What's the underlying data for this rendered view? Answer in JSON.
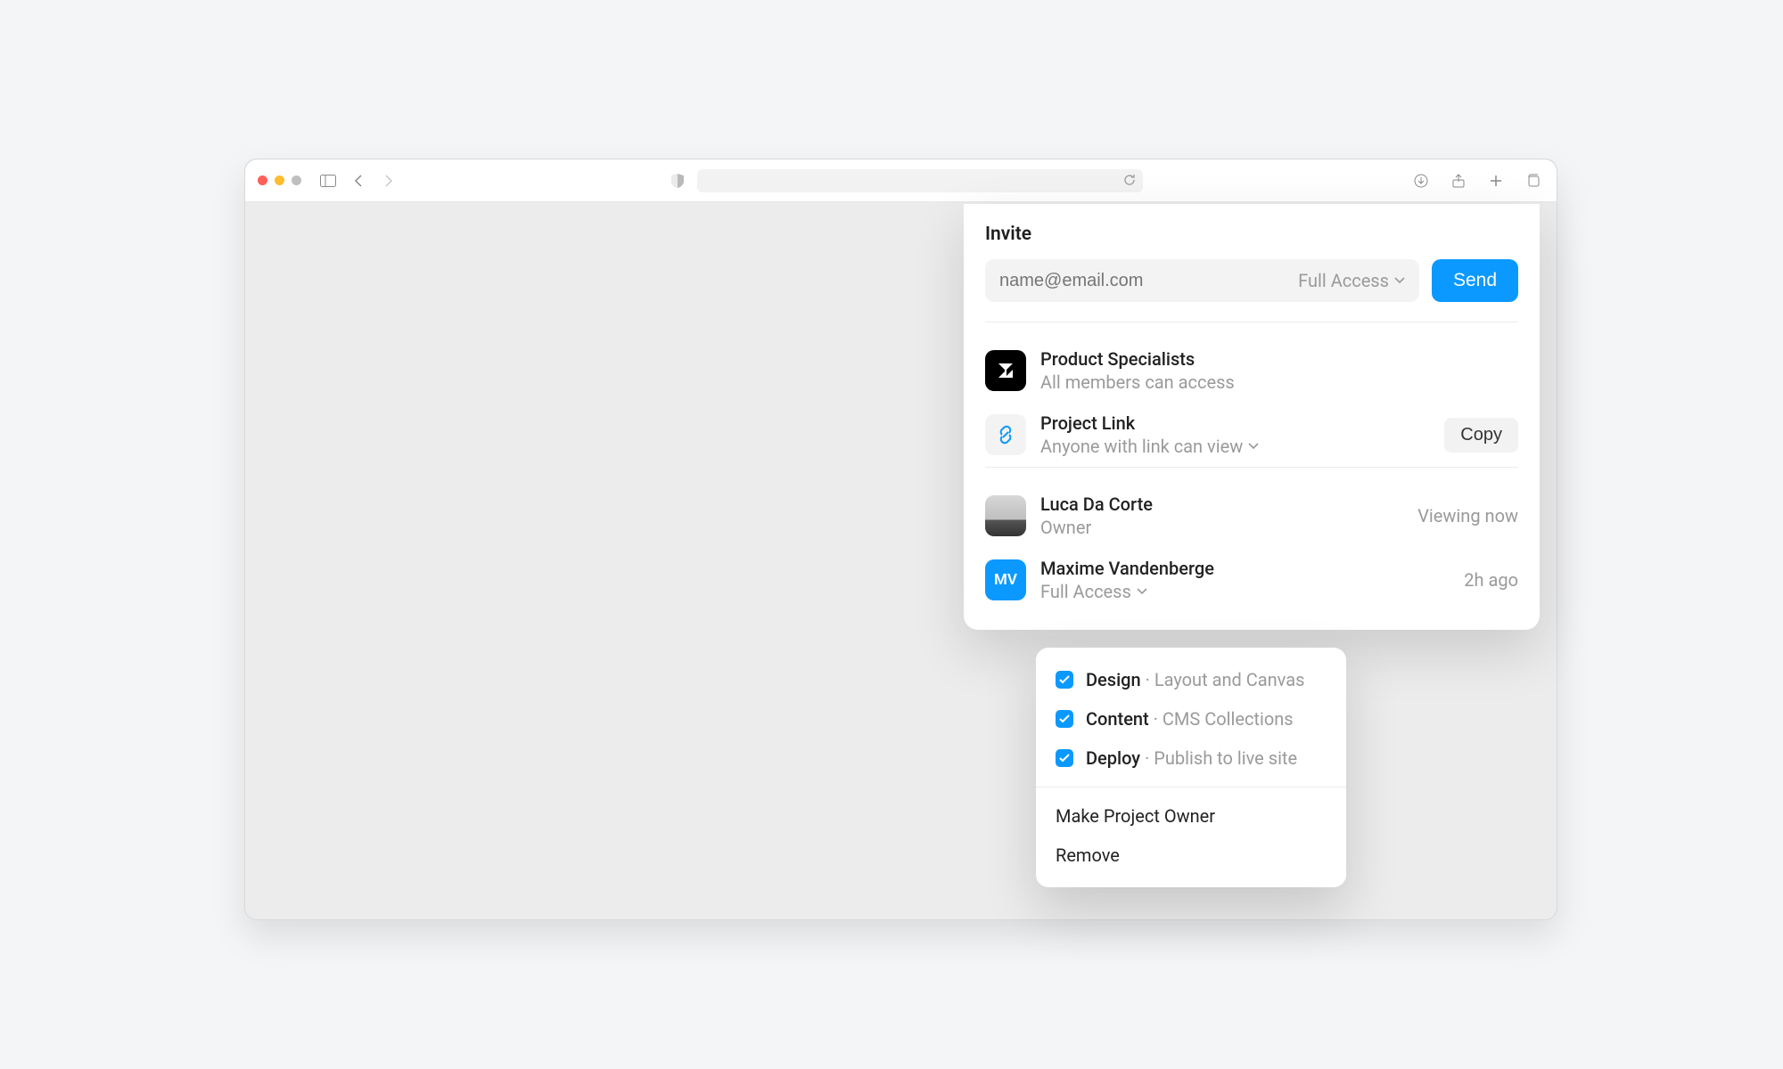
{
  "invite": {
    "title": "Invite",
    "placeholder": "name@email.com",
    "role_default": "Full Access",
    "send": "Send"
  },
  "team": {
    "name": "Product Specialists",
    "sub": "All members can access"
  },
  "link": {
    "title": "Project Link",
    "sub": "Anyone with link can view",
    "copy": "Copy"
  },
  "members": [
    {
      "name": "Luca Da Corte",
      "role": "Owner",
      "status": "Viewing now",
      "initials": ""
    },
    {
      "name": "Maxime Vandenberge",
      "role": "Full Access",
      "status": "2h ago",
      "initials": "MV"
    }
  ],
  "permissions": {
    "options": [
      {
        "label": "Design",
        "detail": "Layout and Canvas"
      },
      {
        "label": "Content",
        "detail": "CMS Collections"
      },
      {
        "label": "Deploy",
        "detail": "Publish to live site"
      }
    ],
    "make_owner": "Make Project Owner",
    "remove": "Remove"
  }
}
